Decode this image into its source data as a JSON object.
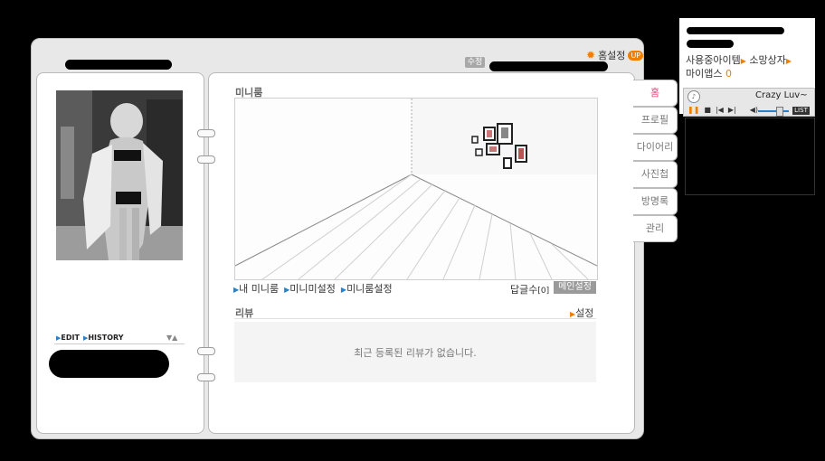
{
  "header": {
    "edit_small_label": "수정",
    "home_settings_label": "홈설정",
    "up_badge": "UP"
  },
  "left": {
    "edit_label": "EDIT",
    "history_label": "HISTORY"
  },
  "miniroom": {
    "title": "미니룸",
    "links": [
      "내 미니룸",
      "미니미설정",
      "미니룸설정"
    ],
    "reply_count_label": "답글수",
    "reply_count_value": "[0]",
    "main_settings_label": "메인설정"
  },
  "review": {
    "title": "리뷰",
    "settings_label": "설정",
    "empty_message": "최근 등록된 리뷰가 없습니다."
  },
  "tabs": [
    {
      "label": "홈",
      "active": true
    },
    {
      "label": "프로필",
      "active": false
    },
    {
      "label": "다이어리",
      "active": false
    },
    {
      "label": "사진첩",
      "active": false
    },
    {
      "label": "방명록",
      "active": false
    },
    {
      "label": "관리",
      "active": false
    }
  ],
  "widget": {
    "items_label": "사용중아이템",
    "wishbox_label": "소망상자",
    "apps_label": "마이앱스",
    "apps_count": "0"
  },
  "player": {
    "track_title": "Crazy Luv~",
    "list_label": "LIST"
  },
  "colors": {
    "accent_orange": "#f07f00",
    "accent_blue": "#2a7fc6",
    "active_tab_pink": "#e0457a"
  }
}
